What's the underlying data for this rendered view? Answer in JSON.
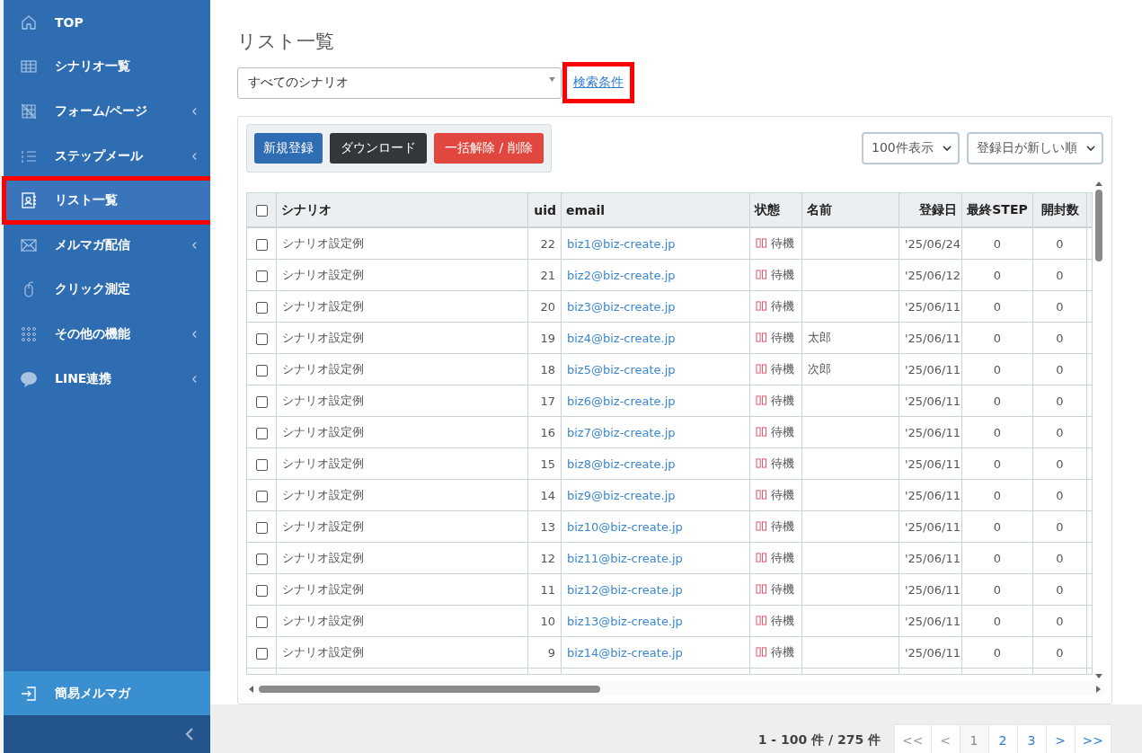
{
  "sidebar": {
    "items": [
      {
        "label": "TOP",
        "selected": false,
        "submenu": false,
        "highlighted": false
      },
      {
        "label": "シナリオ一覧",
        "selected": false,
        "submenu": false,
        "highlighted": false
      },
      {
        "label": "フォーム/ページ",
        "selected": false,
        "submenu": true,
        "highlighted": false
      },
      {
        "label": "ステップメール",
        "selected": false,
        "submenu": true,
        "highlighted": false
      },
      {
        "label": "リスト一覧",
        "selected": true,
        "submenu": false,
        "highlighted": true
      },
      {
        "label": "メルマガ配信",
        "selected": false,
        "submenu": true,
        "highlighted": false
      },
      {
        "label": "クリック測定",
        "selected": false,
        "submenu": false,
        "highlighted": false
      },
      {
        "label": "その他の機能",
        "selected": false,
        "submenu": true,
        "highlighted": false
      },
      {
        "label": "LINE連携",
        "selected": false,
        "submenu": true,
        "highlighted": false
      }
    ],
    "bottom_item": {
      "label": "簡易メルマガ"
    }
  },
  "page": {
    "title": "リスト一覧",
    "scenario_select": {
      "value": "すべてのシナリオ"
    },
    "search_link": {
      "label": "検索条件",
      "highlighted": true
    }
  },
  "toolbar": {
    "buttons": [
      {
        "label": "新規登録",
        "kind": "primary"
      },
      {
        "label": "ダウンロード",
        "kind": "dark"
      },
      {
        "label": "一括解除 / 削除",
        "kind": "danger"
      }
    ],
    "per_page_select": {
      "value": "100件表示"
    },
    "sort_select": {
      "value": "登録日が新しい順"
    }
  },
  "table": {
    "select_all_checked": false,
    "columns": [
      "シナリオ",
      "uid",
      "email",
      "状態",
      "名前",
      "登録日",
      "最終STEP",
      "開封数"
    ],
    "rows": [
      {
        "checked": false,
        "scenario": "シナリオ設定例",
        "uid": "22",
        "email": "biz1@biz-create.jp",
        "status": "待機",
        "name": "",
        "date": "'25/06/24",
        "last_step": "0",
        "opens": "0"
      },
      {
        "checked": false,
        "scenario": "シナリオ設定例",
        "uid": "21",
        "email": "biz2@biz-create.jp",
        "status": "待機",
        "name": "",
        "date": "'25/06/12",
        "last_step": "0",
        "opens": "0"
      },
      {
        "checked": false,
        "scenario": "シナリオ設定例",
        "uid": "20",
        "email": "biz3@biz-create.jp",
        "status": "待機",
        "name": "",
        "date": "'25/06/11",
        "last_step": "0",
        "opens": "0"
      },
      {
        "checked": false,
        "scenario": "シナリオ設定例",
        "uid": "19",
        "email": "biz4@biz-create.jp",
        "status": "待機",
        "name": "太郎",
        "date": "'25/06/11",
        "last_step": "0",
        "opens": "0"
      },
      {
        "checked": false,
        "scenario": "シナリオ設定例",
        "uid": "18",
        "email": "biz5@biz-create.jp",
        "status": "待機",
        "name": "次郎",
        "date": "'25/06/11",
        "last_step": "0",
        "opens": "0"
      },
      {
        "checked": false,
        "scenario": "シナリオ設定例",
        "uid": "17",
        "email": "biz6@biz-create.jp",
        "status": "待機",
        "name": "",
        "date": "'25/06/11",
        "last_step": "0",
        "opens": "0"
      },
      {
        "checked": false,
        "scenario": "シナリオ設定例",
        "uid": "16",
        "email": "biz7@biz-create.jp",
        "status": "待機",
        "name": "",
        "date": "'25/06/11",
        "last_step": "0",
        "opens": "0"
      },
      {
        "checked": false,
        "scenario": "シナリオ設定例",
        "uid": "15",
        "email": "biz8@biz-create.jp",
        "status": "待機",
        "name": "",
        "date": "'25/06/11",
        "last_step": "0",
        "opens": "0"
      },
      {
        "checked": false,
        "scenario": "シナリオ設定例",
        "uid": "14",
        "email": "biz9@biz-create.jp",
        "status": "待機",
        "name": "",
        "date": "'25/06/11",
        "last_step": "0",
        "opens": "0"
      },
      {
        "checked": false,
        "scenario": "シナリオ設定例",
        "uid": "13",
        "email": "biz10@biz-create.jp",
        "status": "待機",
        "name": "",
        "date": "'25/06/11",
        "last_step": "0",
        "opens": "0"
      },
      {
        "checked": false,
        "scenario": "シナリオ設定例",
        "uid": "12",
        "email": "biz11@biz-create.jp",
        "status": "待機",
        "name": "",
        "date": "'25/06/11",
        "last_step": "0",
        "opens": "0"
      },
      {
        "checked": false,
        "scenario": "シナリオ設定例",
        "uid": "11",
        "email": "biz12@biz-create.jp",
        "status": "待機",
        "name": "",
        "date": "'25/06/11",
        "last_step": "0",
        "opens": "0"
      },
      {
        "checked": false,
        "scenario": "シナリオ設定例",
        "uid": "10",
        "email": "biz13@biz-create.jp",
        "status": "待機",
        "name": "",
        "date": "'25/06/11",
        "last_step": "0",
        "opens": "0"
      },
      {
        "checked": false,
        "scenario": "シナリオ設定例",
        "uid": "9",
        "email": "biz14@biz-create.jp",
        "status": "待機",
        "name": "",
        "date": "'25/06/11",
        "last_step": "0",
        "opens": "0"
      }
    ]
  },
  "pagination": {
    "summary": "1 - 100 件 / 275 件",
    "items": [
      {
        "label": "<<",
        "selected": false,
        "disabled": true
      },
      {
        "label": "<",
        "selected": false,
        "disabled": true
      },
      {
        "label": "1",
        "selected": true,
        "disabled": false
      },
      {
        "label": "2",
        "selected": false,
        "disabled": false
      },
      {
        "label": "3",
        "selected": false,
        "disabled": false
      },
      {
        "label": ">",
        "selected": false,
        "disabled": false
      },
      {
        "label": ">>",
        "selected": false,
        "disabled": false
      }
    ]
  }
}
